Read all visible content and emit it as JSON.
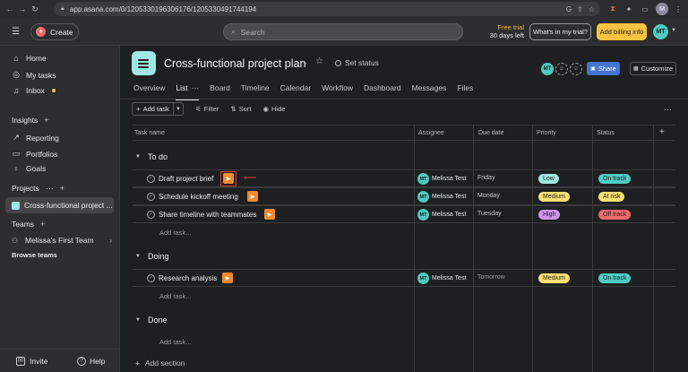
{
  "browser": {
    "url": "app.asana.com/0/1205330196306176/1205330491744194",
    "profile_initial": "M"
  },
  "topbar": {
    "create_label": "Create",
    "search_placeholder": "Search",
    "trial_line1": "Free trial",
    "trial_line2": "30 days left",
    "whats_in_trial": "What's in my trial?",
    "add_billing": "Add billing info",
    "avatar": "MT"
  },
  "sidebar": {
    "home": "Home",
    "my_tasks": "My tasks",
    "inbox": "Inbox",
    "insights": "Insights",
    "reporting": "Reporting",
    "portfolios": "Portfolios",
    "goals": "Goals",
    "projects": "Projects",
    "project_item": "Cross-functional project ...",
    "teams": "Teams",
    "team_item": "Melissa's First Team",
    "browse_teams": "Browse teams",
    "invite": "Invite",
    "help": "Help"
  },
  "project": {
    "title": "Cross-functional project plan",
    "set_status": "Set status",
    "member_initials": "MT",
    "share": "Share",
    "customize": "Customize"
  },
  "tabs": [
    "Overview",
    "List",
    "Board",
    "Timeline",
    "Calendar",
    "Workflow",
    "Dashboard",
    "Messages",
    "Files"
  ],
  "toolbar": {
    "add_task": "Add task",
    "filter": "Filter",
    "sort": "Sort",
    "hide": "Hide"
  },
  "columns": [
    "Task name",
    "Assignee",
    "Due date",
    "Priority",
    "Status"
  ],
  "sections": [
    {
      "name": "To do",
      "tasks": [
        {
          "name": "Draft project brief",
          "assignee": "Melissa Test",
          "initials": "MT",
          "due": "Friday",
          "priority": "Low",
          "status": "On track"
        },
        {
          "name": "Schedule kickoff meeting",
          "assignee": "Melissa Test",
          "initials": "MT",
          "due": "Monday",
          "priority": "Medium",
          "status": "At risk"
        },
        {
          "name": "Share timeline with teammates",
          "assignee": "Melissa Test",
          "initials": "MT",
          "due": "Tuesday",
          "priority": "High",
          "status": "Off track"
        }
      ],
      "add_task": "Add task..."
    },
    {
      "name": "Doing",
      "tasks": [
        {
          "name": "Research analysis",
          "assignee": "Melissa Test",
          "initials": "MT",
          "due": "Tomorrow",
          "priority": "Medium",
          "status": "On track"
        }
      ],
      "add_task": "Add task..."
    },
    {
      "name": "Done",
      "tasks": [],
      "add_task": "Add task..."
    }
  ],
  "add_section": "Add section",
  "colors": {
    "low": "#9ee7e3",
    "medium": "#f8df72",
    "high": "#cd95ea",
    "on_track": "#4ecbc4",
    "at_risk": "#f8df72",
    "off_track": "#f06a6a",
    "highlight": "#d83a3a"
  }
}
